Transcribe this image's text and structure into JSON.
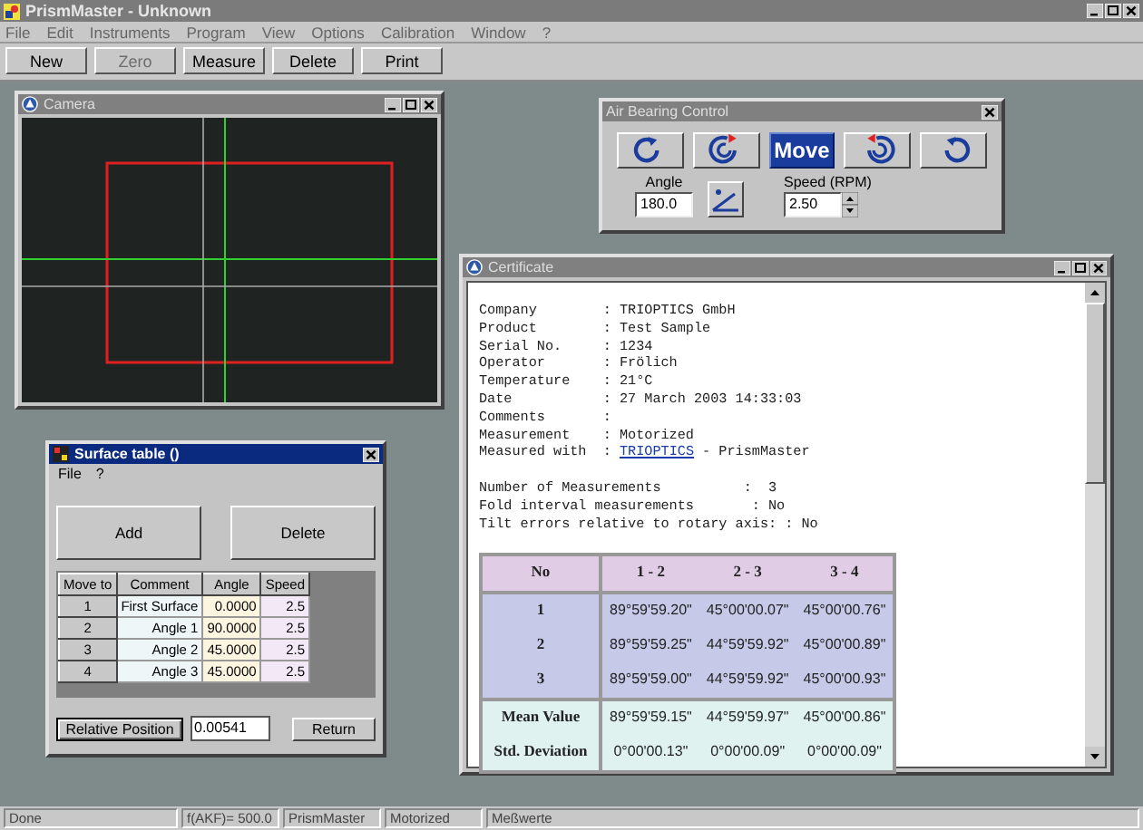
{
  "window": {
    "title": "PrismMaster - Unknown"
  },
  "menu": [
    "File",
    "Edit",
    "Instruments",
    "Program",
    "View",
    "Options",
    "Calibration",
    "Window",
    "?"
  ],
  "toolbar": [
    {
      "label": "New",
      "disabled": false
    },
    {
      "label": "Zero",
      "disabled": true
    },
    {
      "label": "Measure",
      "disabled": false
    },
    {
      "label": "Delete",
      "disabled": false
    },
    {
      "label": "Print",
      "disabled": false
    }
  ],
  "camera": {
    "title": "Camera"
  },
  "air_bearing": {
    "title": "Air Bearing Control",
    "buttons": [
      {
        "kind": "rotate-cw",
        "selected": false
      },
      {
        "kind": "step-cw",
        "selected": false
      },
      {
        "kind": "text",
        "label": "Move",
        "selected": true
      },
      {
        "kind": "step-ccw",
        "selected": false
      },
      {
        "kind": "rotate-ccw",
        "selected": false
      }
    ],
    "angle": {
      "label": "Angle",
      "value": "180.0"
    },
    "speed": {
      "label": "Speed (RPM)",
      "value": "2.50"
    }
  },
  "certificate": {
    "title": "Certificate",
    "lines": [
      {
        "text": "Company        : TRIOPTICS GmbH"
      },
      {
        "text": "Product        : Test Sample"
      },
      {
        "text": "Serial No.     : 1234"
      },
      {
        "text": "Operator       : Frölich"
      },
      {
        "text": "Temperature    : 21°C"
      },
      {
        "text": "Date           : 27 March 2003 14:33:03"
      },
      {
        "text": "Comments       :"
      },
      {
        "text": "Measurement    : Motorized"
      },
      {
        "text": "Measured with  : ",
        "link": "TRIOPTICS",
        "after": " - PrismMaster"
      }
    ],
    "summary": [
      {
        "text": "Number of Measurements          :  3"
      },
      {
        "text": "Fold interval measurements       : No"
      },
      {
        "text": "Tilt errors relative to rotary axis: : No"
      }
    ],
    "table": {
      "columns": [
        "No",
        "1 - 2",
        "2 - 3",
        "3 - 4"
      ],
      "rows": [
        {
          "kind": "measurement",
          "cells": [
            "1",
            "89°59'59.20\"",
            "45°00'00.07\"",
            "45°00'00.76\""
          ]
        },
        {
          "kind": "measurement",
          "cells": [
            "2",
            "89°59'59.25\"",
            "44°59'59.92\"",
            "45°00'00.89\""
          ]
        },
        {
          "kind": "measurement",
          "cells": [
            "3",
            "89°59'59.00\"",
            "44°59'59.92\"",
            "45°00'00.93\""
          ]
        },
        {
          "kind": "statistic",
          "cells": [
            "Mean Value",
            "89°59'59.15\"",
            "44°59'59.97\"",
            "45°00'00.86\""
          ]
        },
        {
          "kind": "statistic",
          "cells": [
            "Std. Deviation",
            "0°00'00.13\"",
            "0°00'00.09\"",
            "0°00'00.09\""
          ]
        }
      ]
    }
  },
  "surface_table": {
    "title": "Surface table ()",
    "menu": [
      "File",
      "?"
    ],
    "add_button": "Add",
    "delete_button": "Delete",
    "columns": [
      "Move to",
      "Comment",
      "Angle",
      "Speed"
    ],
    "rows": [
      [
        "1",
        "First Surface",
        "0.0000",
        "2.5"
      ],
      [
        "2",
        "Angle 1",
        "90.0000",
        "2.5"
      ],
      [
        "3",
        "Angle 2",
        "45.0000",
        "2.5"
      ],
      [
        "4",
        "Angle 3",
        "45.0000",
        "2.5"
      ]
    ],
    "relative_button": "Relative Position",
    "relative_value": "0.00541",
    "return_button": "Return"
  },
  "status_bar": [
    "Done",
    "f(AKF)= 500.0",
    "PrismMaster",
    "Motorized",
    "Meßwerte"
  ]
}
